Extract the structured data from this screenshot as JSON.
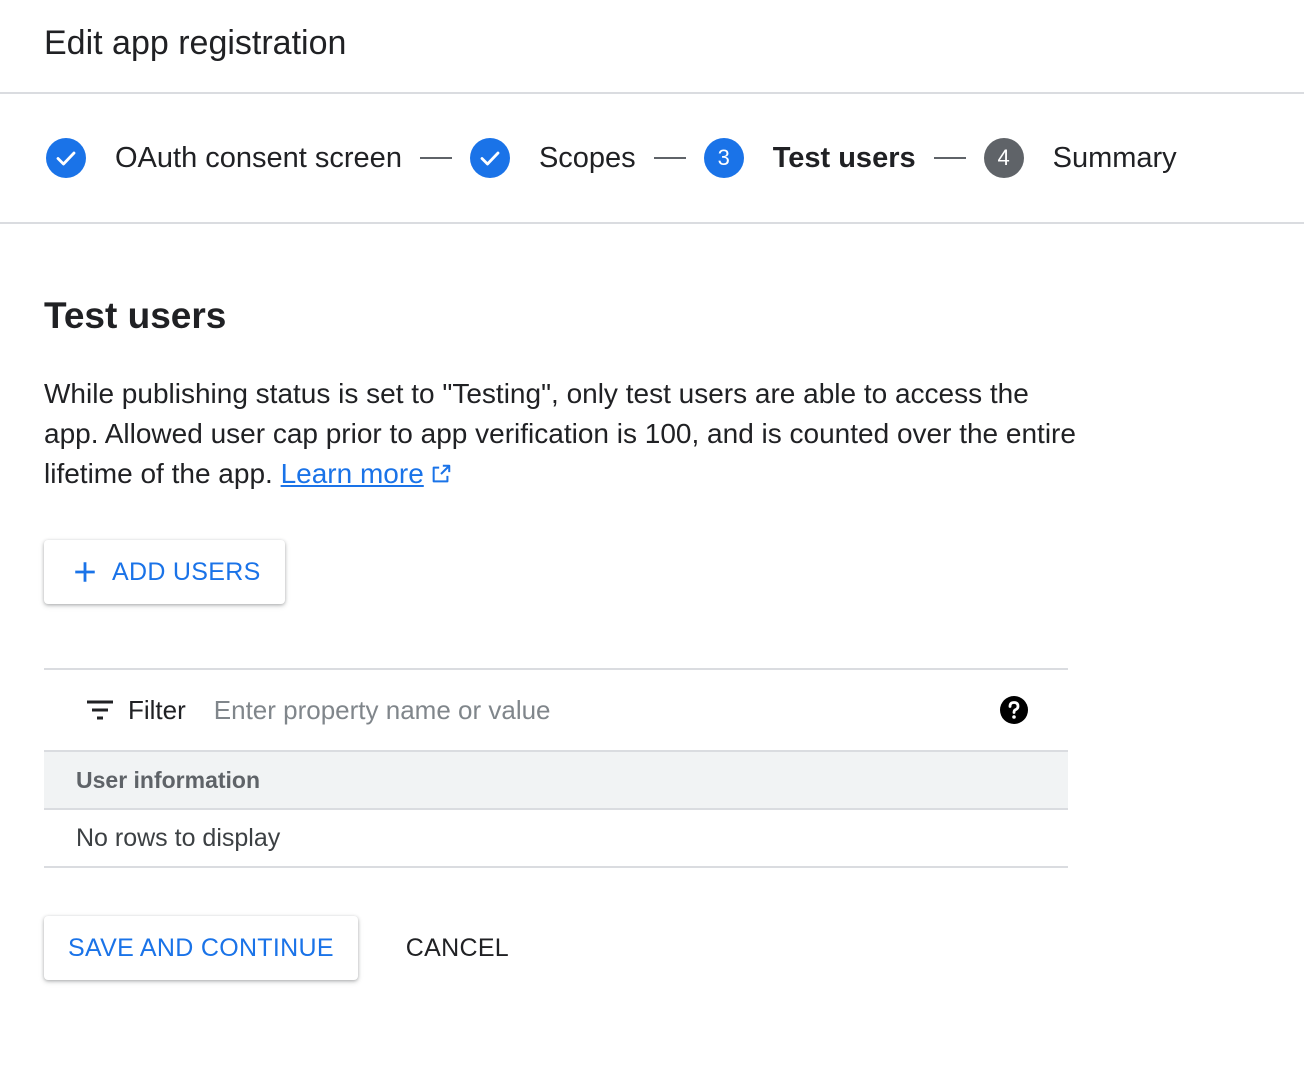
{
  "header": {
    "title": "Edit app registration"
  },
  "stepper": {
    "steps": [
      {
        "label": "OAuth consent screen",
        "state": "done",
        "icon": "check-icon"
      },
      {
        "label": "Scopes",
        "state": "done",
        "icon": "check-icon"
      },
      {
        "label": "Test users",
        "state": "active",
        "number": "3"
      },
      {
        "label": "Summary",
        "state": "pending",
        "number": "4"
      }
    ]
  },
  "section": {
    "title": "Test users",
    "description": "While publishing status is set to \"Testing\", only test users are able to access the app. Allowed user cap prior to app verification is 100, and is counted over the entire lifetime of the app.",
    "learn_more": "Learn more"
  },
  "add_users": {
    "label": "ADD USERS",
    "icon": "plus-icon"
  },
  "table": {
    "filter_label": "Filter",
    "filter_placeholder": "Enter property name or value",
    "columns": [
      "User information"
    ],
    "empty_text": "No rows to display"
  },
  "actions": {
    "save_label": "SAVE AND CONTINUE",
    "cancel_label": "CANCEL"
  },
  "colors": {
    "accent": "#1a73e8",
    "pending": "#5f6368",
    "divider": "#dadce0"
  }
}
